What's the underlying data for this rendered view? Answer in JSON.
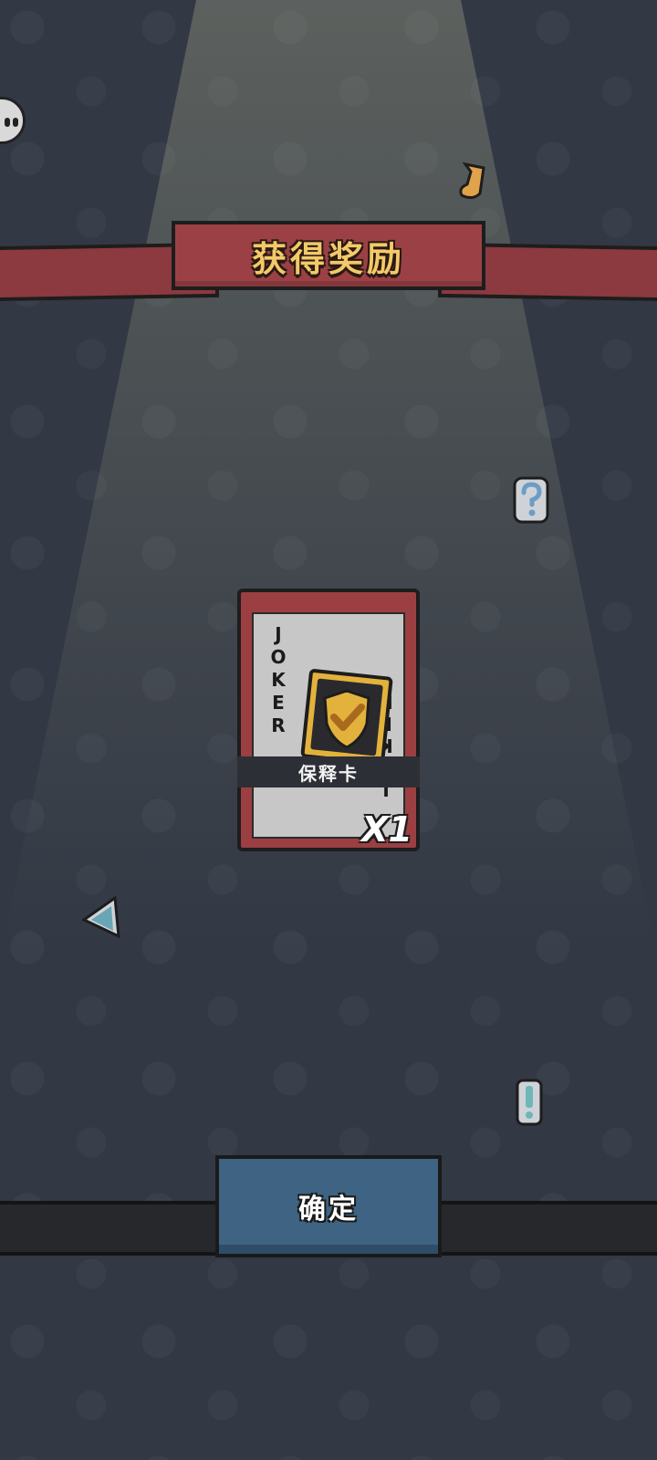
{
  "banner": {
    "title": "获得奖励"
  },
  "reward_card": {
    "corner_text_top": "JOKER",
    "corner_text_bottom": "JOKER",
    "name": "保释卡",
    "count": "X1",
    "icon": "shield-check-icon"
  },
  "actions": {
    "confirm_label": "确定"
  },
  "decorations": [
    "music-note-icon",
    "question-mark-icon",
    "triangle-shard-icon",
    "exclamation-mark-icon"
  ],
  "colors": {
    "background": "#323844",
    "banner_red": "#9b4146",
    "title_gold": "#f3c96a",
    "card_red": "#9b3f43",
    "button_blue": "#3f6383"
  }
}
